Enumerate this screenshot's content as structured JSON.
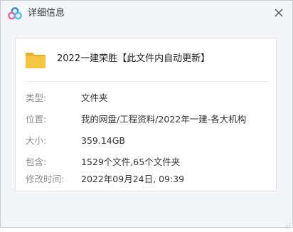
{
  "window": {
    "title": "详细信息",
    "app_icon": "baidu-netdisk-cloud-icon",
    "close_icon": "close-icon"
  },
  "file": {
    "icon": "folder-icon",
    "name": "2022一建荣胜【此文件内自动更新】"
  },
  "details": [
    {
      "label": "类型:",
      "value": "文件夹"
    },
    {
      "label": "位置:",
      "value": "我的网盘/工程资料/2022年一建-各大机构"
    },
    {
      "label": "大小:",
      "value": "359.14GB"
    },
    {
      "label": "包含:",
      "value": "1529个文件,65个文件夹"
    },
    {
      "label": "修改时间:",
      "value": "2022年09月24日, 09:39"
    }
  ],
  "colors": {
    "window_bg": "#f4f5f8",
    "panel_bg": "#ffffff",
    "folder": "#f5c742",
    "label_text": "#8c8f96",
    "value_text": "#333333"
  }
}
